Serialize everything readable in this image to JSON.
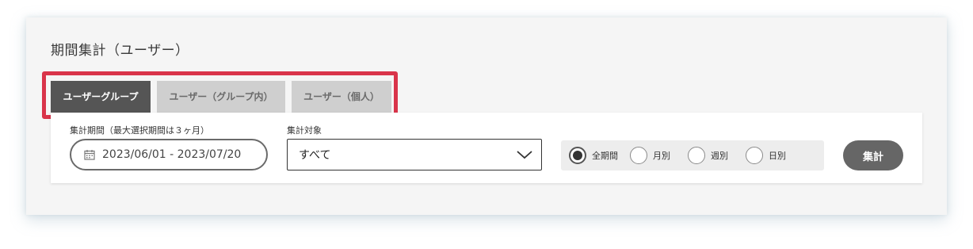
{
  "panel": {
    "title": "期間集計（ユーザー）"
  },
  "tabs": [
    {
      "label": "ユーザーグループ",
      "active": true
    },
    {
      "label": "ユーザー（グループ内）",
      "active": false
    },
    {
      "label": "ユーザー（個人）",
      "active": false
    }
  ],
  "filters": {
    "period_label": "集計期間（最大選択期間は３ヶ月）",
    "period_value": "2023/06/01 - 2023/07/20",
    "target_label": "集計対象",
    "target_value": "すべて",
    "granularity": {
      "options": [
        "全期間",
        "月別",
        "週別",
        "日別"
      ],
      "selected": "全期間"
    },
    "submit_label": "集計"
  },
  "colors": {
    "accent_highlight": "#d9344a",
    "active_tab": "#555555",
    "inactive_tab": "#cfcfcf",
    "button": "#666666"
  },
  "icons": {
    "calendar": "calendar-icon",
    "dropdown": "chevron-down-icon"
  }
}
